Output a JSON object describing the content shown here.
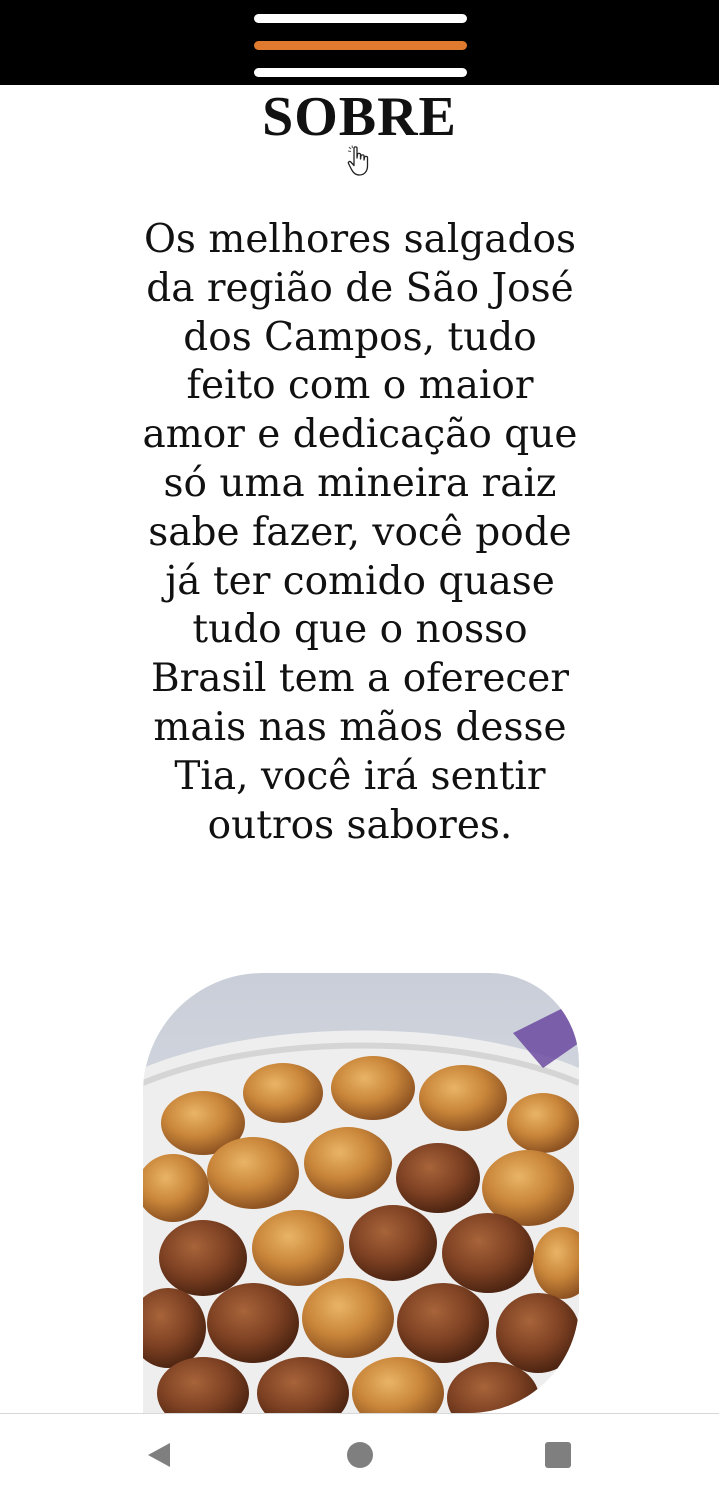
{
  "header": {
    "menu_icon": "hamburger-menu-icon",
    "line_colors": [
      "#ffffff",
      "#e07a2e",
      "#ffffff"
    ]
  },
  "about": {
    "title": "SOBRE",
    "text": "Os melhores salgados da região de São José dos Campos, tudo feito com o maior amor e dedicação que só uma mineira raiz sabe fazer, você pode já ter comido quase tudo que o nosso Brasil tem a oferecer mais nas mãos desse Tia, você irá sentir outros sabores.",
    "cursor_icon": "hand-pointer-icon",
    "image": {
      "subject": "fried snacks (salgados) in a paper-lined bowl"
    }
  },
  "navigation_bar": {
    "back_icon": "back-triangle-icon",
    "home_icon": "home-circle-icon",
    "recents_icon": "recents-square-icon"
  },
  "colors": {
    "header_bg": "#000000",
    "accent": "#e07a2e",
    "text": "#111111",
    "nav_icon": "#7f7f7f"
  }
}
